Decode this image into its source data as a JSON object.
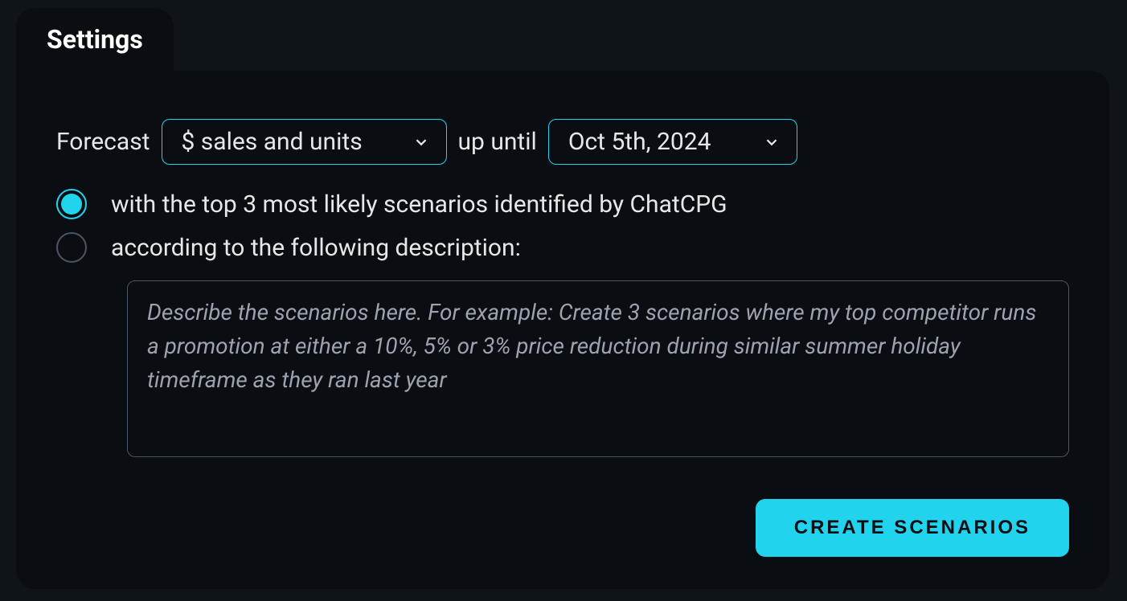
{
  "tab": {
    "title": "Settings"
  },
  "forecast": {
    "label": "Forecast",
    "metric_selected": "$ sales and units",
    "up_until_label": "up until",
    "date_selected": "Oct 5th, 2024"
  },
  "options": {
    "option1_label": "with the top 3 most likely scenarios identified by ChatCPG",
    "option2_label": "according to the following description:",
    "selected": 1
  },
  "textarea": {
    "placeholder": "Describe the scenarios here. For example: Create 3 scenarios where my top competitor runs a promotion at either a 10%, 5% or 3% price reduction during similar summer holiday timeframe as they ran last year",
    "value": ""
  },
  "button": {
    "create_label": "CREATE SCENARIOS"
  }
}
